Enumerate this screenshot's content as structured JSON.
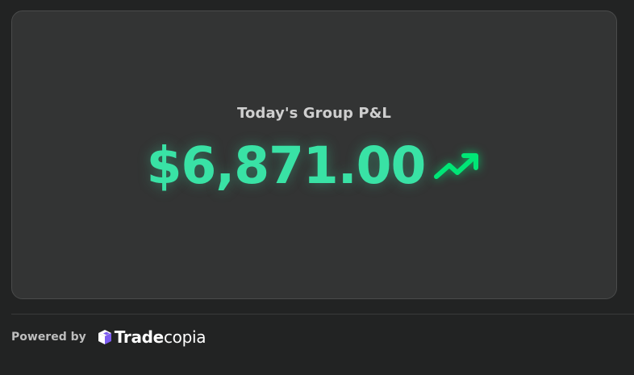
{
  "card": {
    "title": "Today's Group P&L",
    "value": "$6,871.00",
    "trend_icon": "trending-up-arrow",
    "value_color": "#39e2a5",
    "trend_color": "#00e676"
  },
  "footer": {
    "powered_by": "Powered by",
    "brand_name_bold": "Trade",
    "brand_name_light": "copia",
    "logo_icon": "cube-logo",
    "logo_color": "#7c5cf0"
  }
}
